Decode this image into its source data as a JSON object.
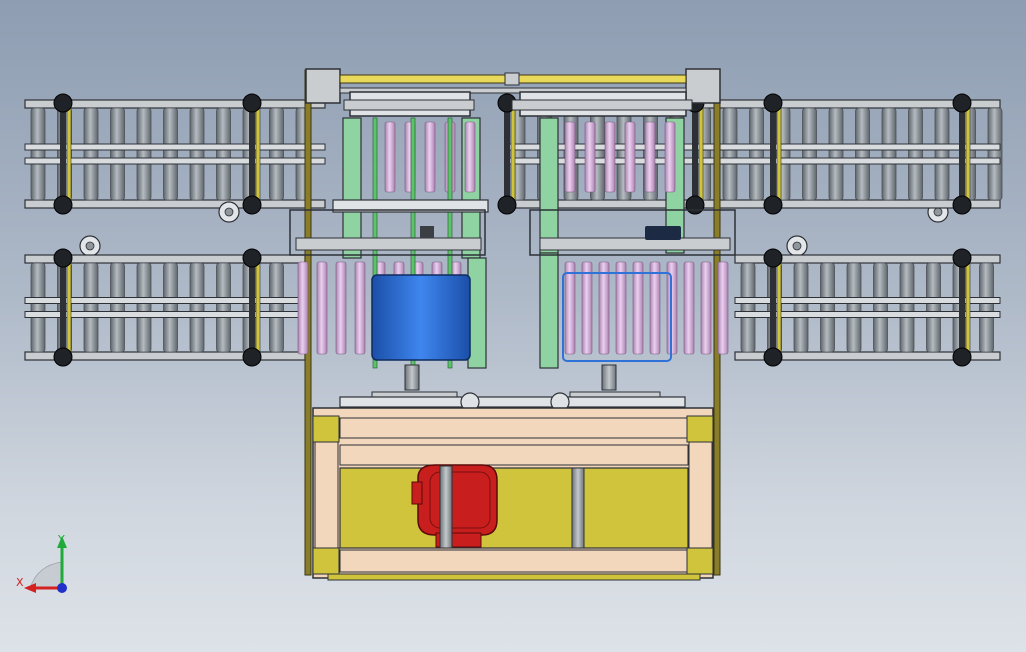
{
  "view": {
    "background_top": "#8e9db2",
    "background_bottom": "#dde2e8"
  },
  "colors": {
    "frame_dark": "#2d3136",
    "frame_light": "#c9cdd0",
    "roller": "#8f969c",
    "roller_shade": "#5f666c",
    "roller_pink": "#d4acd9",
    "cylinder_blue": "#2f72d8",
    "plate_green": "#8fd3a3",
    "tube_green": "#5cc26b",
    "base_yellow": "#cfc43c",
    "wood_panel": "#f2d7bd",
    "robot_red": "#c81e1e",
    "rail_yellow": "#e9d95a",
    "post_olive": "#8a7d2a"
  },
  "triad": {
    "x_label": "X",
    "y_label": "Y",
    "x_color": "#d42020",
    "y_color": "#1faa3a",
    "z_color": "#2030c8"
  }
}
